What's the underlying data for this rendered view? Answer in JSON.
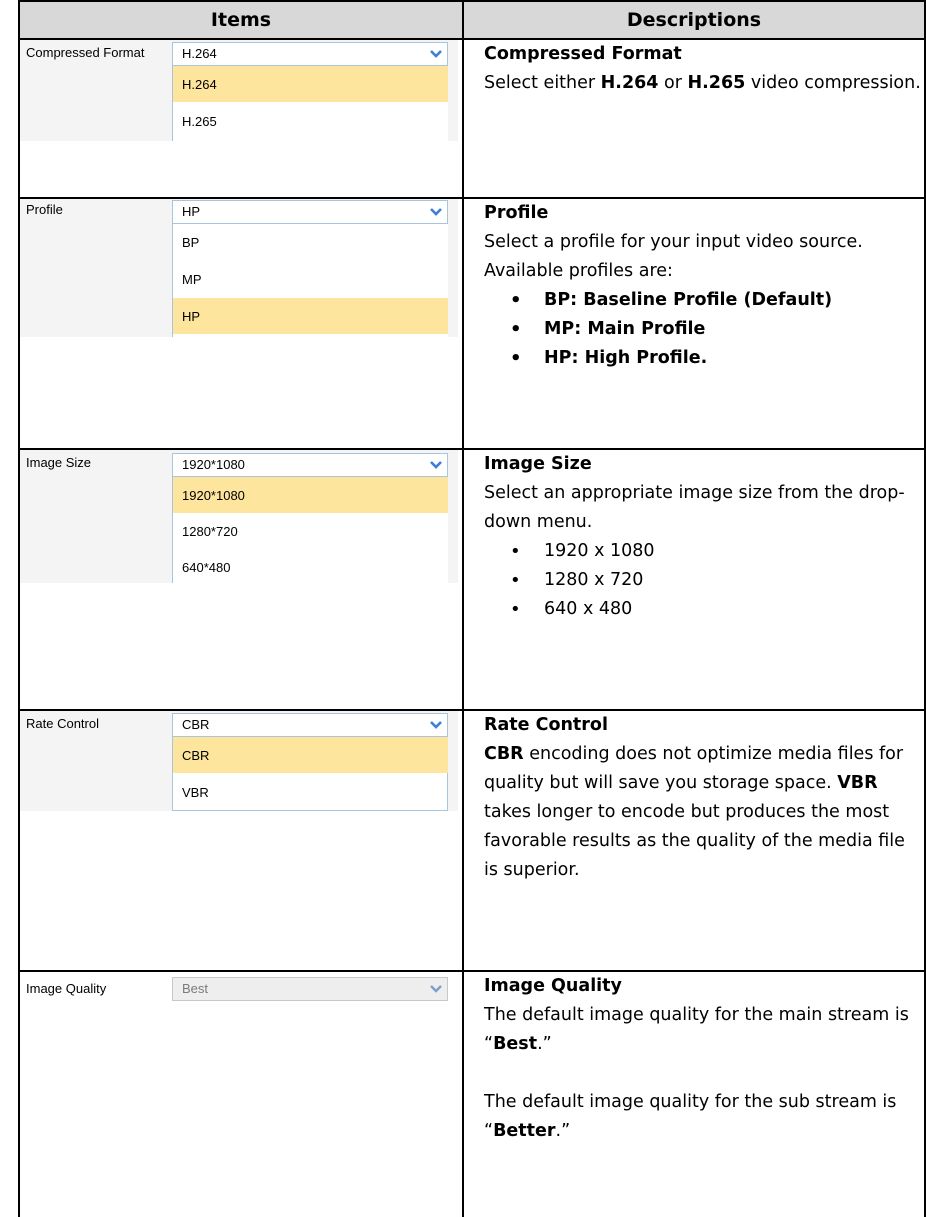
{
  "table": {
    "headers": [
      "Items",
      "Descriptions"
    ]
  },
  "rows": [
    {
      "label": "Compressed Format",
      "selected": "H.264",
      "options": [
        "H.264",
        "H.265"
      ],
      "highlighted": "H.264",
      "desc_title": "Compressed Format",
      "desc": {
        "p1": "Select either ",
        "b1": "H.264",
        "p2": " or ",
        "b2": "H.265",
        "p3": " video compression."
      }
    },
    {
      "label": "Profile",
      "selected": "HP",
      "options": [
        "BP",
        "MP",
        "HP"
      ],
      "highlighted": "HP",
      "desc_title": "Profile",
      "desc_text": "Select a profile for your input video source. Available profiles are:",
      "bullets": [
        "BP: Baseline Profile (Default)",
        "MP: Main Profile",
        "HP: High Profile."
      ]
    },
    {
      "label": "Image Size",
      "selected": "1920*1080",
      "options": [
        "1920*1080",
        "1280*720",
        "640*480"
      ],
      "highlighted": "1920*1080",
      "desc_title": "Image Size",
      "desc_text": "Select an appropriate image size from the drop-down menu.",
      "bullets": [
        "1920 x 1080",
        "1280 x 720",
        "640 x 480"
      ]
    },
    {
      "label": "Rate Control",
      "selected": "CBR",
      "options": [
        "CBR",
        "VBR"
      ],
      "highlighted": "CBR",
      "desc_title": "Rate Control",
      "desc": {
        "b1": "CBR",
        "p1": " encoding does not optimize media files for quality but will save you storage space. ",
        "b2": "VBR",
        "p2": " takes longer to encode but produces the most favorable results as the quality of the media file is superior."
      }
    },
    {
      "label": "Image Quality",
      "selected": "Best",
      "disabled": true,
      "desc_title": "Image Quality",
      "desc": {
        "p1": "The default image quality for the main stream is “",
        "b1": "Best",
        "p2": ".”",
        "p3": "The default image quality for the sub stream is “",
        "b2": "Better",
        "p4": ".”"
      }
    }
  ],
  "colors": {
    "highlight": "#fde59e",
    "header_bg": "#d8d8d8",
    "select_border": "#a9c4dd",
    "arrow": "#3d7fd6"
  }
}
